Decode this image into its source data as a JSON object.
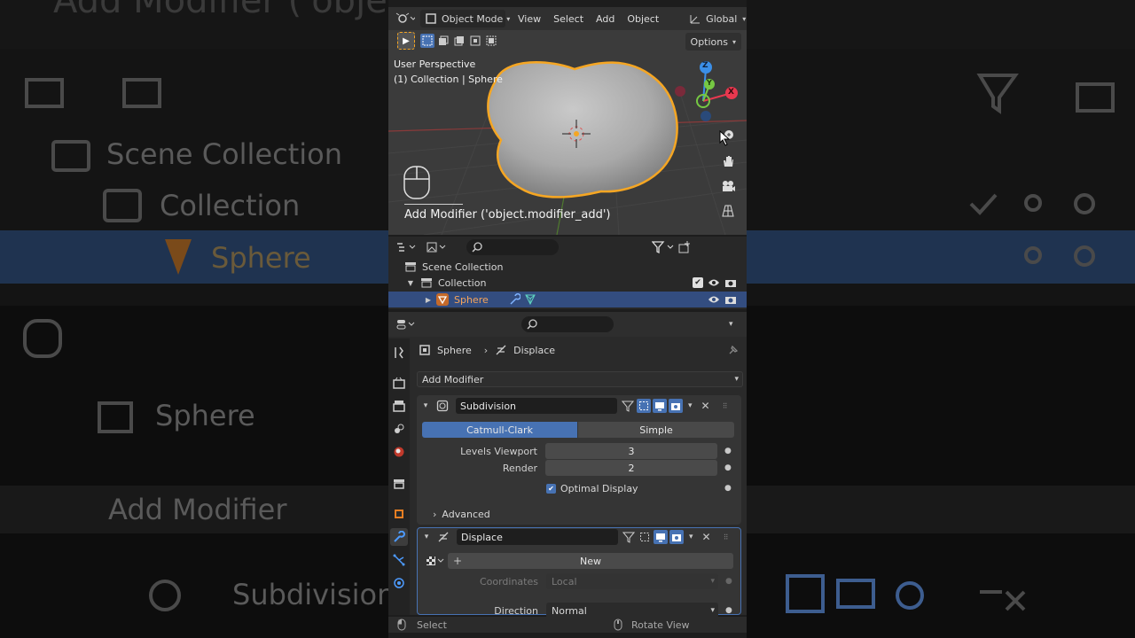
{
  "background": {
    "title_partial": "Add Modifier ('object",
    "scene_collection": "Scene Collection",
    "collection": "Collection",
    "sphere": "Sphere",
    "breadcrumb_object": "Sphere",
    "add_modifier": "Add Modifier",
    "subdivision": "Subdivision"
  },
  "viewport": {
    "mode_label": "Object Mode",
    "menu": [
      "View",
      "Select",
      "Add",
      "Object"
    ],
    "transform_orientation": "Global",
    "options_label": "Options",
    "perspective_label": "User Perspective",
    "collection_label": "(1) Collection | Sphere",
    "operator_tooltip": "Add Modifier ('object.modifier_add')",
    "gizmo": {
      "x": "X",
      "y": "Y",
      "z": "Z"
    }
  },
  "outliner": {
    "search_placeholder": "",
    "scene_collection": "Scene Collection",
    "collection": "Collection",
    "object": "Sphere"
  },
  "properties": {
    "search_placeholder": "",
    "breadcrumb_object": "Sphere",
    "breadcrumb_modifier": "Displace",
    "add_modifier_label": "Add Modifier",
    "subdivision": {
      "name": "Subdivision",
      "mode_catmull": "Catmull-Clark",
      "mode_simple": "Simple",
      "levels_viewport_label": "Levels Viewport",
      "levels_viewport_value": "3",
      "render_label": "Render",
      "render_value": "2",
      "optimal_display_label": "Optimal Display",
      "optimal_display_checked": true,
      "advanced_label": "Advanced"
    },
    "displace": {
      "name": "Displace",
      "new_label": "New",
      "coordinates_label": "Coordinates",
      "coordinates_value": "Local",
      "direction_label": "Direction",
      "direction_value": "Normal"
    }
  },
  "status_bar": {
    "select_label": "Select",
    "rotate_label": "Rotate View"
  },
  "colors": {
    "accent": "#4772b3",
    "selection_outline": "#f5a623",
    "axis_x": "#e8384f",
    "axis_y": "#76c843",
    "axis_z": "#3b8fe8"
  }
}
